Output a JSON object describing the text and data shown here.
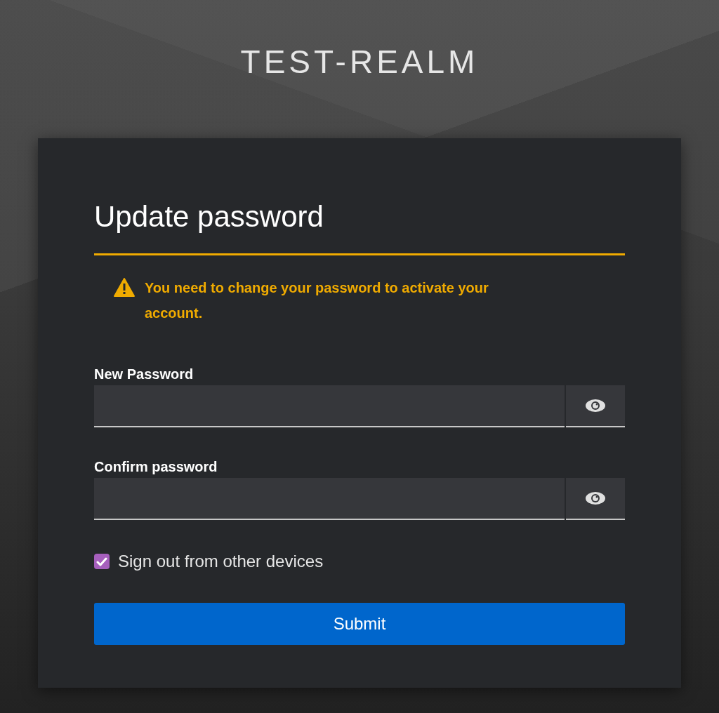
{
  "realm": "TEST-REALM",
  "title": "Update password",
  "alert": {
    "kind": "warning",
    "text": "You need to change your password to activate your account."
  },
  "fields": [
    {
      "label": "New Password",
      "revealed": false
    },
    {
      "label": "Confirm password",
      "revealed": false
    }
  ],
  "sign_out": {
    "label": "Sign out from other devices",
    "checked": true
  },
  "submit": "Submit"
}
